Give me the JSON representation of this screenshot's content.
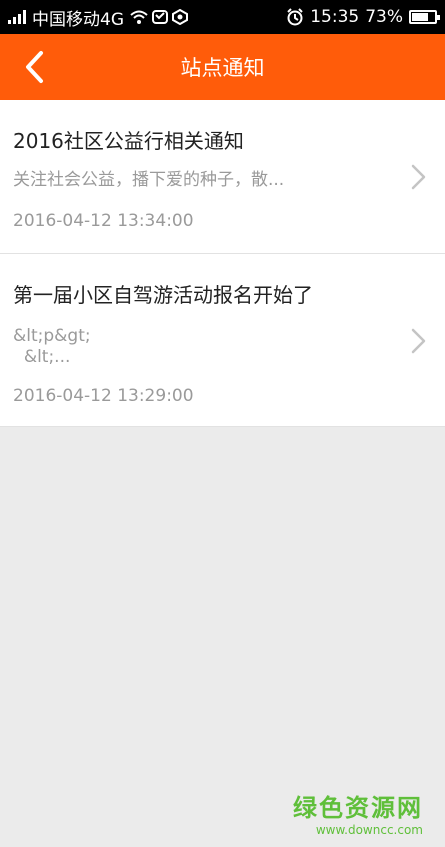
{
  "status_bar": {
    "carrier": "中国移动4G",
    "time": "15:35",
    "battery": "73%",
    "battery_level": 0.73,
    "icons": [
      "signal-icon",
      "wifi-icon",
      "call-icon",
      "location-icon",
      "alarm-icon",
      "battery-icon"
    ]
  },
  "header": {
    "title": "站点通知",
    "accent_color": "#ff5c0a"
  },
  "notifications": [
    {
      "title": "2016社区公益行相关通知",
      "summary": "关注社会公益，播下爱的种子，散...",
      "time": "2016-04-12 13:34:00"
    },
    {
      "title": "第一届小区自驾游活动报名开始了",
      "summary": "&lt;p&gt;\n  &lt;...",
      "time": "2016-04-12 13:29:00"
    }
  ],
  "watermark": {
    "name": "绿色资源网",
    "url": "www.downcc.com"
  }
}
